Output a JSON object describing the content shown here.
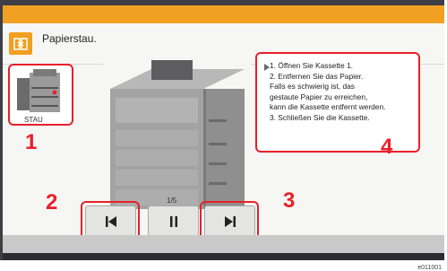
{
  "dialog": {
    "title": "Papierstau.",
    "icon": "paper-jam-icon",
    "thumbnail_label": "STAU",
    "page_indicator": "1/5",
    "instructions": [
      "1. Öffnen Sie Kassette 1.",
      "2. Entfernen Sie das Papier.",
      "Falls es schwierig ist, das",
      "gestaute Papier zu erreichen,",
      "kann die Kassette entfernt werden.",
      "3. Schließen Sie die Kassette."
    ]
  },
  "controls": {
    "first_icon": "skip-to-first-icon",
    "pause_icon": "pause-icon",
    "next_icon": "skip-to-next-icon"
  },
  "callouts": [
    "1",
    "2",
    "3",
    "4"
  ],
  "doc_id": "e011001",
  "colors": {
    "accent": "#f1a021",
    "highlight": "#e8202a",
    "frame": "#3e3e46"
  }
}
